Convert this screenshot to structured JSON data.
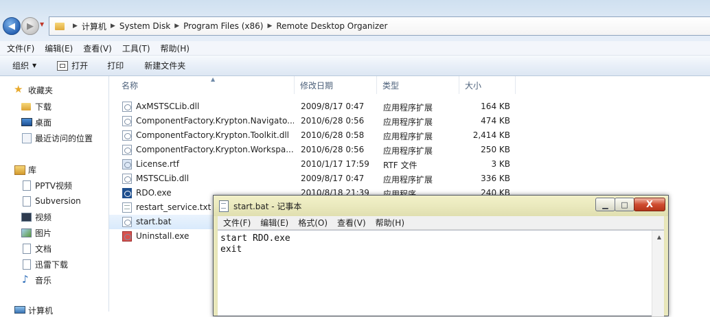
{
  "explorer": {
    "breadcrumbs": [
      "计算机",
      "System Disk",
      "Program Files (x86)",
      "Remote Desktop Organizer"
    ],
    "menu": [
      "文件(F)",
      "编辑(E)",
      "查看(V)",
      "工具(T)",
      "帮助(H)"
    ],
    "toolbar": {
      "organize": "组织",
      "open": "打开",
      "print": "打印",
      "new_folder": "新建文件夹"
    },
    "nav": {
      "favorites": "收藏夹",
      "downloads": "下载",
      "desktop": "桌面",
      "recent": "最近访问的位置",
      "libraries": "库",
      "pptv": "PPTV视频",
      "subversion": "Subversion",
      "videos": "视频",
      "pictures": "图片",
      "documents": "文档",
      "thunder": "迅雷下载",
      "music": "音乐",
      "computer": "计算机"
    },
    "columns": {
      "name": "名称",
      "date": "修改日期",
      "type": "类型",
      "size": "大小"
    },
    "files": [
      {
        "name": "AxMSTSCLib.dll",
        "date": "2009/8/17 0:47",
        "type": "应用程序扩展",
        "size": "164 KB"
      },
      {
        "name": "ComponentFactory.Krypton.Navigato...",
        "date": "2010/6/28 0:56",
        "type": "应用程序扩展",
        "size": "474 KB"
      },
      {
        "name": "ComponentFactory.Krypton.Toolkit.dll",
        "date": "2010/6/28 0:58",
        "type": "应用程序扩展",
        "size": "2,414 KB"
      },
      {
        "name": "ComponentFactory.Krypton.Workspa...",
        "date": "2010/6/28 0:56",
        "type": "应用程序扩展",
        "size": "250 KB"
      },
      {
        "name": "License.rtf",
        "date": "2010/1/17 17:59",
        "type": "RTF 文件",
        "size": "3 KB"
      },
      {
        "name": "MSTSCLib.dll",
        "date": "2009/8/17 0:47",
        "type": "应用程序扩展",
        "size": "336 KB"
      },
      {
        "name": "RDO.exe",
        "date": "2010/8/18 21:39",
        "type": "应用程序",
        "size": "240 KB"
      },
      {
        "name": "restart_service.txt",
        "date": "",
        "type": "",
        "size": ""
      },
      {
        "name": "start.bat",
        "date": "",
        "type": "",
        "size": ""
      },
      {
        "name": "Uninstall.exe",
        "date": "",
        "type": "",
        "size": ""
      }
    ]
  },
  "notepad": {
    "title": "start.bat - 记事本",
    "menu": [
      "文件(F)",
      "编辑(E)",
      "格式(O)",
      "查看(V)",
      "帮助(H)"
    ],
    "content": "start RDO.exe\nexit",
    "controls": {
      "minimize": "▁",
      "maximize": "□",
      "close": "X"
    }
  }
}
